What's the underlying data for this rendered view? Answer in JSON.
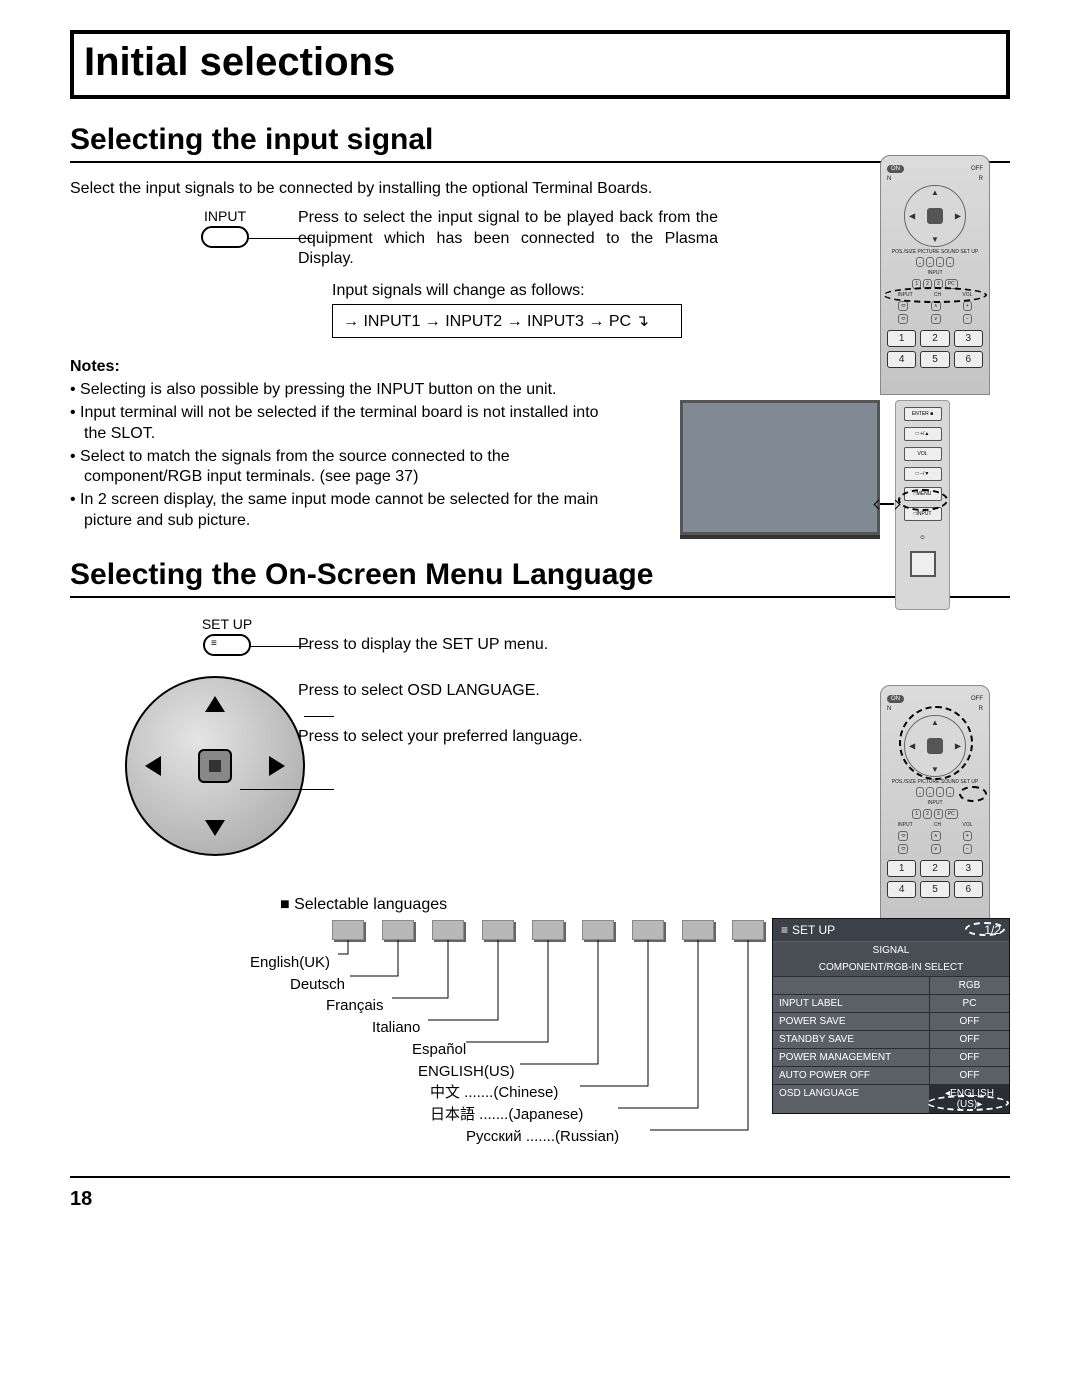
{
  "page_title": "Initial selections",
  "page_number": "18",
  "section1": {
    "heading": "Selecting the input signal",
    "intro": "Select the input signals to be connected by installing the optional Terminal Boards.",
    "input_label": "INPUT",
    "desc": "Press to select the input signal to be played back from the equipment which has been connected to the Plasma Display.",
    "flow_intro": "Input signals will change as follows:",
    "flow": "→ INPUT1 → INPUT2 → INPUT3 → PC ↴",
    "notes_label": "Notes:",
    "notes": [
      "Selecting is also possible by pressing the INPUT button on the unit.",
      "Input terminal will not be selected if the terminal board is not installed into the SLOT.",
      "Select to match the signals from the source connected to the component/RGB input terminals. (see page 37)",
      "In 2 screen display, the same input mode cannot be selected for the main picture and sub picture."
    ]
  },
  "section2": {
    "heading": "Selecting the On-Screen Menu Language",
    "setup_label": "SET UP",
    "step1": "Press to display the SET UP menu.",
    "step2": "Press to select OSD LANGUAGE.",
    "step3": "Press to select your preferred language.",
    "langs_head": "Selectable languages",
    "langs": [
      "English(UK)",
      "Deutsch",
      "Français",
      "Italiano",
      "Español",
      "ENGLISH(US)",
      "中文 .......(Chinese)",
      "日本語 .......(Japanese)",
      "Русский .......(Russian)"
    ]
  },
  "remote": {
    "on": "ON",
    "off": "OFF",
    "n": "N",
    "r": "R",
    "labels": "POS./SIZE PICTURE SOUND SET UP",
    "input_row": "INPUT",
    "nums_small": [
      "1",
      "2",
      "3",
      "PC"
    ],
    "input_btn": "INPUT",
    "ch": "CH",
    "vol": "VOL",
    "keys": [
      "1",
      "2",
      "3",
      "4",
      "5",
      "6"
    ]
  },
  "sidepanel": {
    "enter": "ENTER",
    "vol": "VOL",
    "menu": "MENU",
    "input": "INPUT"
  },
  "osd": {
    "title": "SET UP",
    "page": "1/2",
    "rows": [
      {
        "l": "SIGNAL",
        "r": "",
        "header": true
      },
      {
        "l": "COMPONENT/RGB-IN SELECT",
        "r": "",
        "header": true
      },
      {
        "l": "",
        "r": "RGB"
      },
      {
        "l": "INPUT LABEL",
        "r": "PC"
      },
      {
        "l": "POWER SAVE",
        "r": "OFF"
      },
      {
        "l": "STANDBY SAVE",
        "r": "OFF"
      },
      {
        "l": "POWER MANAGEMENT",
        "r": "OFF"
      },
      {
        "l": "AUTO POWER OFF",
        "r": "OFF"
      },
      {
        "l": "OSD LANGUAGE",
        "r": "◂ENGLISH (US)▸"
      }
    ]
  }
}
